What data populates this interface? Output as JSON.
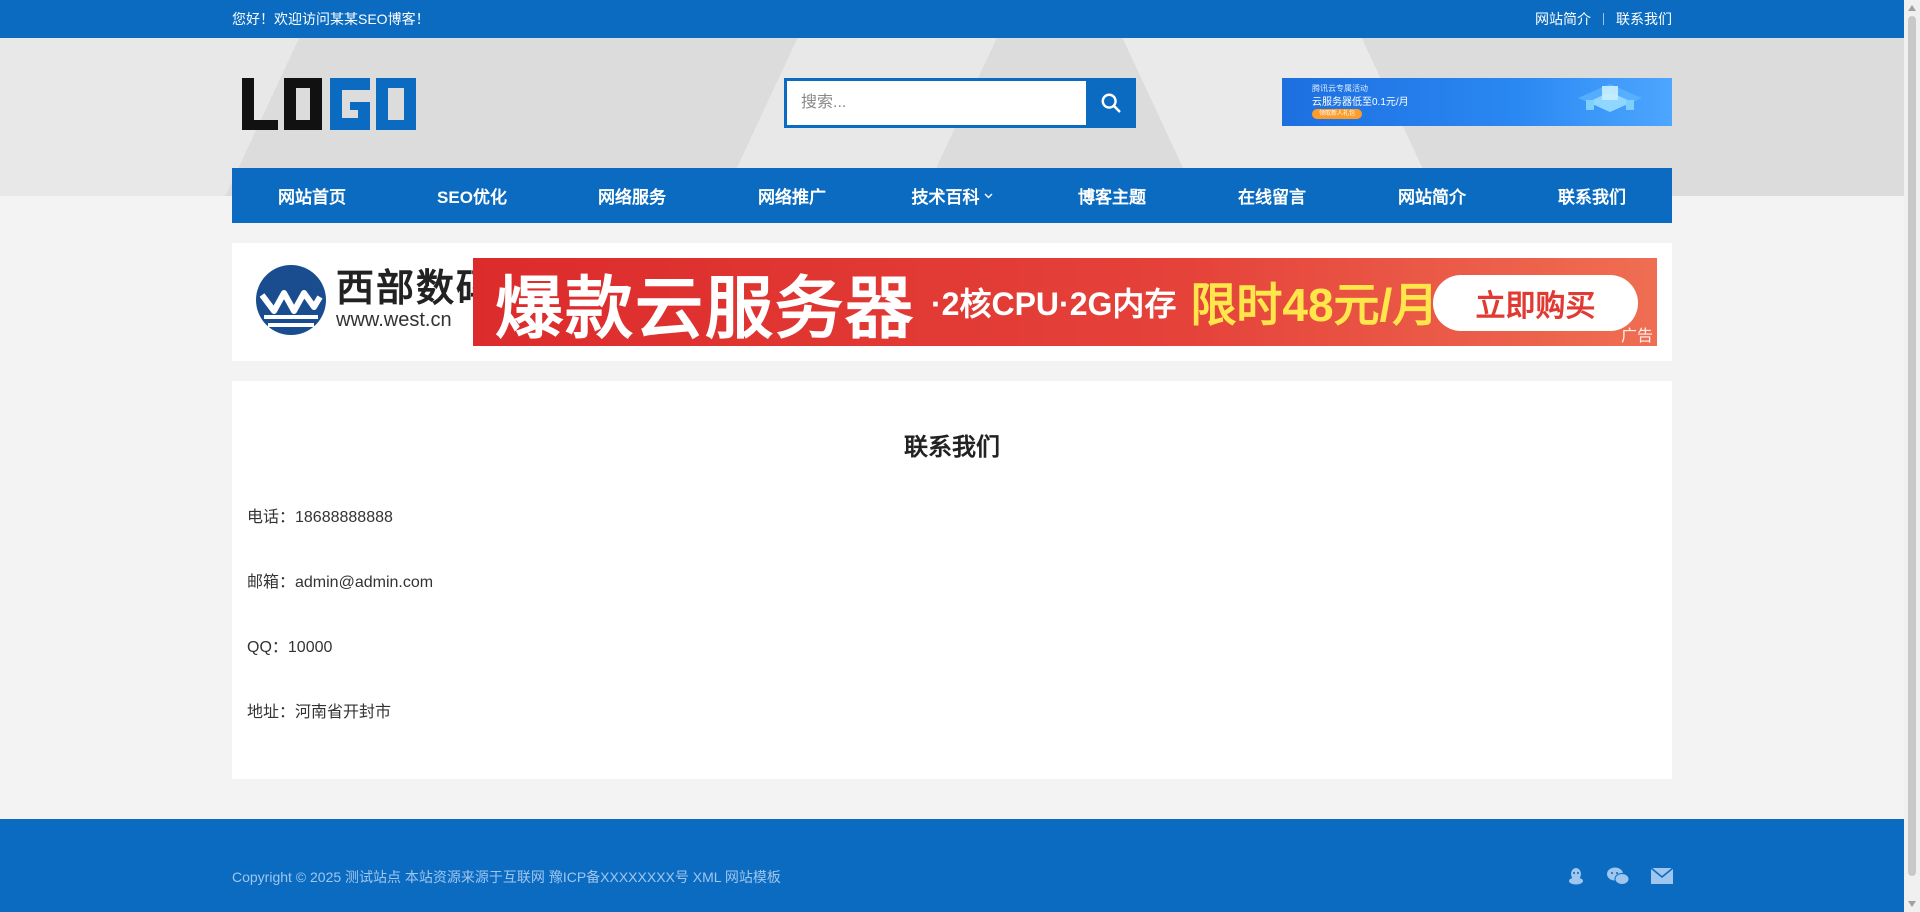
{
  "topbar": {
    "greeting": "您好！欢迎访问某某SEO博客！",
    "links": [
      "网站简介",
      "联系我们"
    ]
  },
  "header": {
    "logo_text": "LOGO",
    "search_placeholder": "搜索...",
    "ad": {
      "line1": "腾讯云专属活动",
      "line2": "云服务器低至0.1元/月",
      "cta": "领取新人礼包"
    }
  },
  "nav": {
    "items": [
      "网站首页",
      "SEO优化",
      "网络服务",
      "网络推广",
      "技术百科",
      "博客主题",
      "在线留言",
      "网站简介",
      "联系我们"
    ],
    "dropdown_index": 4
  },
  "banner": {
    "brand_name": "西部数码",
    "brand_url": "www.west.cn",
    "headline": "爆款云服务器",
    "spec": "·2核CPU·2G内存",
    "promo": "限时48元/月",
    "button": "立即购买",
    "ad_tag": "广告"
  },
  "page": {
    "title": "联系我们",
    "rows": [
      "电话：18688888888",
      "邮箱：admin@admin.com",
      "QQ：10000",
      "地址：河南省开封市"
    ]
  },
  "footer": {
    "copyright": "Copyright © 2025 测试站点 本站资源来源于互联网 豫ICP备XXXXXXXX号 XML 网站模板",
    "icons": [
      "qq-icon",
      "wechat-icon",
      "email-icon"
    ]
  },
  "colors": {
    "primary": "#0a6bc1",
    "banner_red": "#dc2b2b",
    "promo_yellow": "#ffe64a"
  }
}
